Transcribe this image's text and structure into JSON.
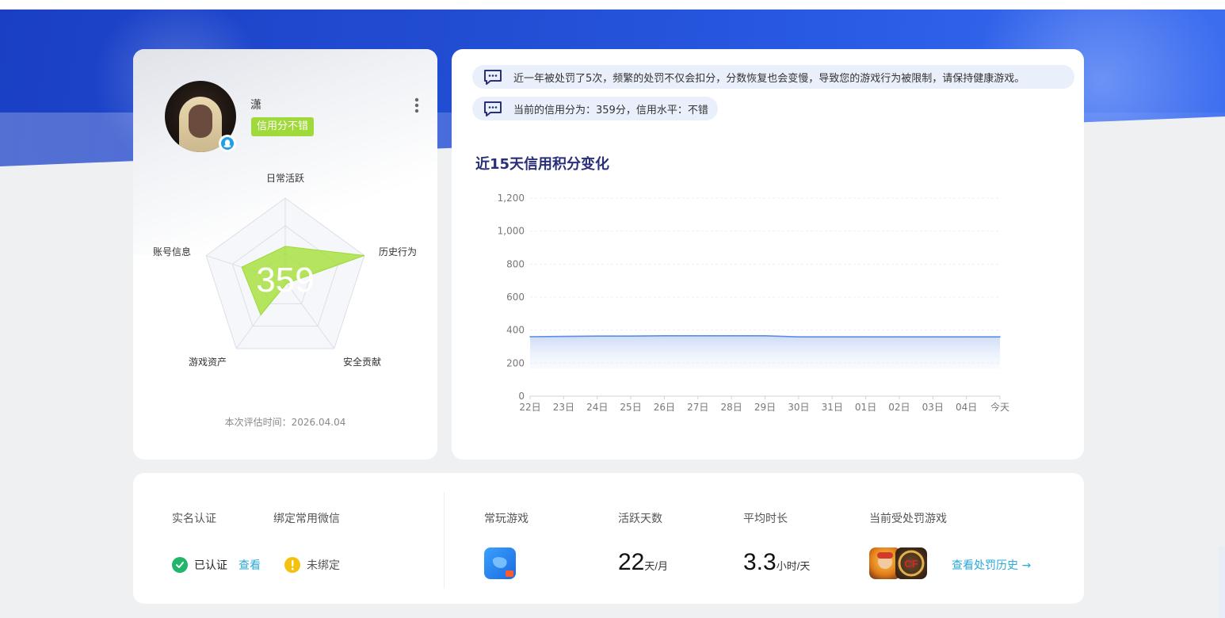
{
  "profile": {
    "username": "潇",
    "credit_tag": "信用分不错",
    "score": "359",
    "radar_labels": {
      "top": "日常活跃",
      "right": "历史行为",
      "bottom_right": "安全贡献",
      "bottom_left": "游戏资产",
      "left": "账号信息"
    },
    "radar_values": [
      0.42,
      1.0,
      0.0,
      0.5,
      0.55
    ],
    "eval_time": "本次评估时间：2026.04.04"
  },
  "notices": [
    "近一年被处罚了5次，频繁的处罚不仅会扣分，分数恢复也会变慢，导致您的游戏行为被限制，请保持健康游戏。",
    "当前的信用分为：359分，信用水平：不错"
  ],
  "chart_title": "近15天信用积分变化",
  "chart_data": {
    "type": "area",
    "title": "近15天信用积分变化",
    "categories": [
      "22日",
      "23日",
      "24日",
      "25日",
      "26日",
      "27日",
      "28日",
      "29日",
      "30日",
      "31日",
      "01日",
      "02日",
      "03日",
      "04日",
      "今天"
    ],
    "values": [
      360,
      362,
      364,
      364,
      366,
      366,
      366,
      366,
      359,
      359,
      359,
      359,
      359,
      359,
      359
    ],
    "ylim": [
      0,
      1200
    ],
    "yticks": [
      0,
      200,
      400,
      600,
      800,
      1000,
      1200
    ],
    "ytick_labels": [
      "0",
      "200",
      "400",
      "600",
      "800",
      "1,000",
      "1,200"
    ],
    "grid": true,
    "color": "#5b8de6"
  },
  "stats": {
    "realname_label": "实名认证",
    "wechat_label": "绑定常用微信",
    "realname_status": "已认证",
    "view_link": "查看",
    "wechat_status": "未绑定",
    "frequent_game_label": "常玩游戏",
    "active_days_label": "活跃天数",
    "active_days_value": "22",
    "active_days_unit": "天/月",
    "avg_duration_label": "平均时长",
    "avg_duration_value": "3.3",
    "avg_duration_unit": "小时/天",
    "penalized_games_label": "当前受处罚游戏",
    "history_link": "查看处罚历史 →"
  }
}
